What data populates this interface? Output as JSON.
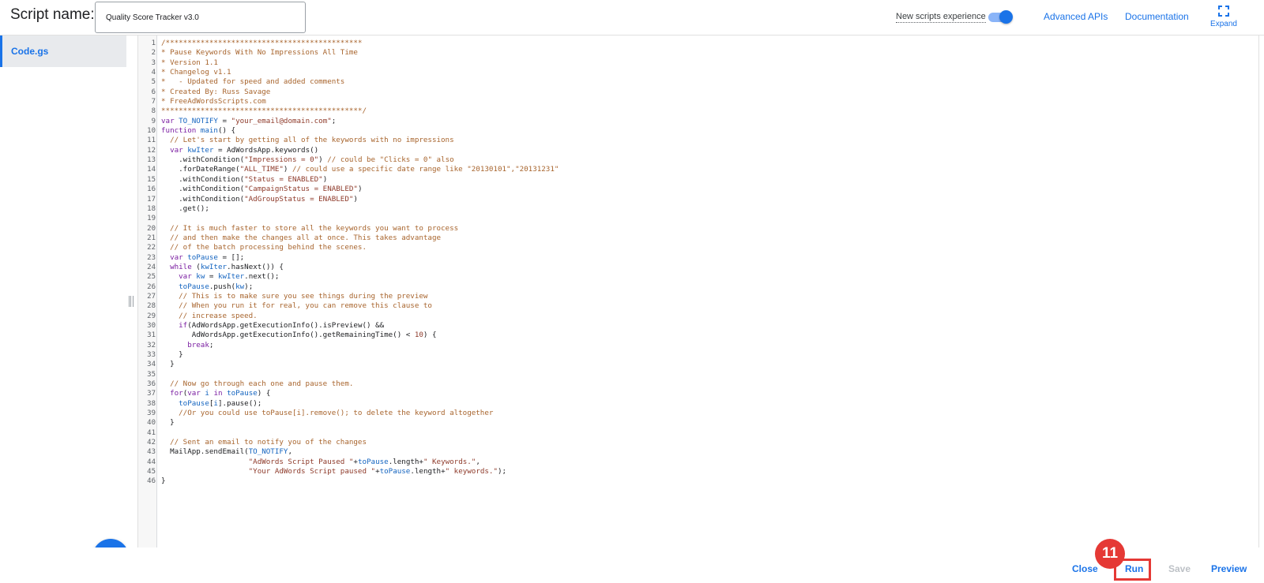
{
  "header": {
    "script_name_label": "Script name:",
    "script_name_value": "Quality Score Tracker v3.0",
    "new_experience_label": "New scripts experience",
    "new_experience_enabled": true,
    "advanced_apis_label": "Advanced APIs",
    "documentation_label": "Documentation",
    "expand_label": "Expand"
  },
  "sidebar": {
    "files": [
      {
        "label": "Code.gs",
        "selected": true
      }
    ],
    "add_button_icon": "plus-icon"
  },
  "editor": {
    "language": "javascript",
    "lines": [
      [
        {
          "t": "comment",
          "v": "/*********************************************"
        }
      ],
      [
        {
          "t": "comment",
          "v": "* Pause Keywords With No Impressions All Time"
        }
      ],
      [
        {
          "t": "comment",
          "v": "* Version 1.1"
        }
      ],
      [
        {
          "t": "comment",
          "v": "* Changelog v1.1"
        }
      ],
      [
        {
          "t": "comment",
          "v": "*   - Updated for speed and added comments"
        }
      ],
      [
        {
          "t": "comment",
          "v": "* Created By: Russ Savage"
        }
      ],
      [
        {
          "t": "comment",
          "v": "* FreeAdWordsScripts.com"
        }
      ],
      [
        {
          "t": "comment",
          "v": "**********************************************/"
        }
      ],
      [
        {
          "t": "keyword",
          "v": "var "
        },
        {
          "t": "var",
          "v": "TO_NOTIFY"
        },
        {
          "t": "plain",
          "v": " = "
        },
        {
          "t": "string",
          "v": "\"your_email@domain.com\""
        },
        {
          "t": "plain",
          "v": ";"
        }
      ],
      [
        {
          "t": "keyword",
          "v": "function "
        },
        {
          "t": "var",
          "v": "main"
        },
        {
          "t": "plain",
          "v": "() {"
        }
      ],
      [
        {
          "t": "plain",
          "v": "  "
        },
        {
          "t": "comment",
          "v": "// Let's start by getting all of the keywords with no impressions"
        }
      ],
      [
        {
          "t": "plain",
          "v": "  "
        },
        {
          "t": "keyword",
          "v": "var "
        },
        {
          "t": "var",
          "v": "kwIter"
        },
        {
          "t": "plain",
          "v": " = AdWordsApp.keywords()"
        }
      ],
      [
        {
          "t": "plain",
          "v": "    .withCondition("
        },
        {
          "t": "string",
          "v": "\"Impressions = 0\""
        },
        {
          "t": "plain",
          "v": ") "
        },
        {
          "t": "comment",
          "v": "// could be \"Clicks = 0\" also"
        }
      ],
      [
        {
          "t": "plain",
          "v": "    .forDateRange("
        },
        {
          "t": "string",
          "v": "\"ALL_TIME\""
        },
        {
          "t": "plain",
          "v": ") "
        },
        {
          "t": "comment",
          "v": "// could use a specific date range like \"20130101\",\"20131231\""
        }
      ],
      [
        {
          "t": "plain",
          "v": "    .withCondition("
        },
        {
          "t": "string",
          "v": "\"Status = ENABLED\""
        },
        {
          "t": "plain",
          "v": ")"
        }
      ],
      [
        {
          "t": "plain",
          "v": "    .withCondition("
        },
        {
          "t": "string",
          "v": "\"CampaignStatus = ENABLED\""
        },
        {
          "t": "plain",
          "v": ")"
        }
      ],
      [
        {
          "t": "plain",
          "v": "    .withCondition("
        },
        {
          "t": "string",
          "v": "\"AdGroupStatus = ENABLED\""
        },
        {
          "t": "plain",
          "v": ")"
        }
      ],
      [
        {
          "t": "plain",
          "v": "    .get();"
        }
      ],
      [
        {
          "t": "plain",
          "v": ""
        }
      ],
      [
        {
          "t": "plain",
          "v": "  "
        },
        {
          "t": "comment",
          "v": "// It is much faster to store all the keywords you want to process"
        }
      ],
      [
        {
          "t": "plain",
          "v": "  "
        },
        {
          "t": "comment",
          "v": "// and then make the changes all at once. This takes advantage"
        }
      ],
      [
        {
          "t": "plain",
          "v": "  "
        },
        {
          "t": "comment",
          "v": "// of the batch processing behind the scenes."
        }
      ],
      [
        {
          "t": "plain",
          "v": "  "
        },
        {
          "t": "keyword",
          "v": "var "
        },
        {
          "t": "var",
          "v": "toPause"
        },
        {
          "t": "plain",
          "v": " = [];"
        }
      ],
      [
        {
          "t": "plain",
          "v": "  "
        },
        {
          "t": "keyword",
          "v": "while "
        },
        {
          "t": "plain",
          "v": "("
        },
        {
          "t": "var",
          "v": "kwIter"
        },
        {
          "t": "plain",
          "v": ".hasNext()) {"
        }
      ],
      [
        {
          "t": "plain",
          "v": "    "
        },
        {
          "t": "keyword",
          "v": "var "
        },
        {
          "t": "var",
          "v": "kw"
        },
        {
          "t": "plain",
          "v": " = "
        },
        {
          "t": "var",
          "v": "kwIter"
        },
        {
          "t": "plain",
          "v": ".next();"
        }
      ],
      [
        {
          "t": "plain",
          "v": "    "
        },
        {
          "t": "var",
          "v": "toPause"
        },
        {
          "t": "plain",
          "v": ".push("
        },
        {
          "t": "var",
          "v": "kw"
        },
        {
          "t": "plain",
          "v": ");"
        }
      ],
      [
        {
          "t": "plain",
          "v": "    "
        },
        {
          "t": "comment",
          "v": "// This is to make sure you see things during the preview"
        }
      ],
      [
        {
          "t": "plain",
          "v": "    "
        },
        {
          "t": "comment",
          "v": "// When you run it for real, you can remove this clause to"
        }
      ],
      [
        {
          "t": "plain",
          "v": "    "
        },
        {
          "t": "comment",
          "v": "// increase speed."
        }
      ],
      [
        {
          "t": "plain",
          "v": "    "
        },
        {
          "t": "keyword",
          "v": "if"
        },
        {
          "t": "plain",
          "v": "(AdWordsApp.getExecutionInfo().isPreview() &&"
        }
      ],
      [
        {
          "t": "plain",
          "v": "       AdWordsApp.getExecutionInfo().getRemainingTime() < "
        },
        {
          "t": "string",
          "v": "10"
        },
        {
          "t": "plain",
          "v": ") {"
        }
      ],
      [
        {
          "t": "plain",
          "v": "      "
        },
        {
          "t": "keyword",
          "v": "break"
        },
        {
          "t": "plain",
          "v": ";"
        }
      ],
      [
        {
          "t": "plain",
          "v": "    }"
        }
      ],
      [
        {
          "t": "plain",
          "v": "  }"
        }
      ],
      [
        {
          "t": "plain",
          "v": ""
        }
      ],
      [
        {
          "t": "plain",
          "v": "  "
        },
        {
          "t": "comment",
          "v": "// Now go through each one and pause them."
        }
      ],
      [
        {
          "t": "plain",
          "v": "  "
        },
        {
          "t": "keyword",
          "v": "for"
        },
        {
          "t": "plain",
          "v": "("
        },
        {
          "t": "keyword",
          "v": "var "
        },
        {
          "t": "var",
          "v": "i"
        },
        {
          "t": "keyword",
          "v": " in "
        },
        {
          "t": "var",
          "v": "toPause"
        },
        {
          "t": "plain",
          "v": ") {"
        }
      ],
      [
        {
          "t": "plain",
          "v": "    "
        },
        {
          "t": "var",
          "v": "toPause"
        },
        {
          "t": "plain",
          "v": "["
        },
        {
          "t": "var",
          "v": "i"
        },
        {
          "t": "plain",
          "v": "].pause();"
        }
      ],
      [
        {
          "t": "plain",
          "v": "    "
        },
        {
          "t": "comment",
          "v": "//Or you could use toPause[i].remove(); to delete the keyword altogether"
        }
      ],
      [
        {
          "t": "plain",
          "v": "  }"
        }
      ],
      [
        {
          "t": "plain",
          "v": ""
        }
      ],
      [
        {
          "t": "plain",
          "v": "  "
        },
        {
          "t": "comment",
          "v": "// Sent an email to notify you of the changes"
        }
      ],
      [
        {
          "t": "plain",
          "v": "  MailApp.sendEmail("
        },
        {
          "t": "var",
          "v": "TO_NOTIFY"
        },
        {
          "t": "plain",
          "v": ","
        }
      ],
      [
        {
          "t": "plain",
          "v": "                    "
        },
        {
          "t": "string",
          "v": "\"AdWords Script Paused \""
        },
        {
          "t": "plain",
          "v": "+"
        },
        {
          "t": "var",
          "v": "toPause"
        },
        {
          "t": "plain",
          "v": ".length+"
        },
        {
          "t": "string",
          "v": "\" Keywords.\""
        },
        {
          "t": "plain",
          "v": ","
        }
      ],
      [
        {
          "t": "plain",
          "v": "                    "
        },
        {
          "t": "string",
          "v": "\"Your AdWords Script paused \""
        },
        {
          "t": "plain",
          "v": "+"
        },
        {
          "t": "var",
          "v": "toPause"
        },
        {
          "t": "plain",
          "v": ".length+"
        },
        {
          "t": "string",
          "v": "\" keywords.\""
        },
        {
          "t": "plain",
          "v": ");"
        }
      ],
      [
        {
          "t": "plain",
          "v": "}"
        }
      ]
    ]
  },
  "footer": {
    "close_label": "Close",
    "run_label": "Run",
    "save_label": "Save",
    "save_enabled": false,
    "preview_label": "Preview",
    "step_badge": "11"
  },
  "colors": {
    "accent": "#1a73e8",
    "highlight": "#e53935",
    "comment": "#a8652e",
    "keyword": "#7b1fa2",
    "string": "#8e3a2a",
    "variable": "#1565c0"
  }
}
